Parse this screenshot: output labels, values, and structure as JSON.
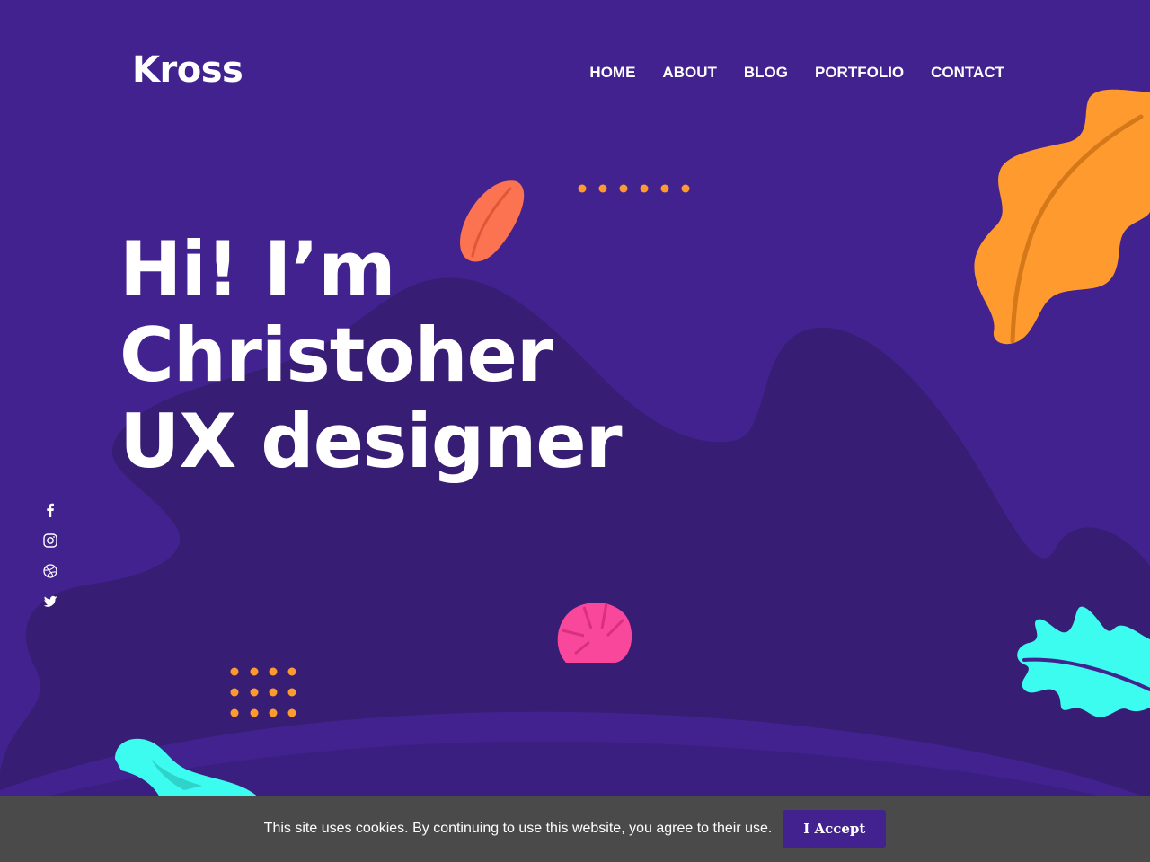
{
  "brand": {
    "logo_text": "Kross"
  },
  "nav": {
    "items": [
      {
        "label": "HOME"
      },
      {
        "label": "ABOUT"
      },
      {
        "label": "BLOG"
      },
      {
        "label": "PORTFOLIO"
      },
      {
        "label": "CONTACT"
      }
    ]
  },
  "hero": {
    "line1": "Hi! I’m",
    "line2": "Christoher",
    "line3": "UX designer"
  },
  "social": {
    "icons": [
      "facebook-icon",
      "instagram-icon",
      "dribbble-icon",
      "twitter-icon"
    ]
  },
  "cookie": {
    "message": "This site uses cookies. By continuing to use this website, you agree to their use.",
    "accept_label": "I Accept"
  },
  "colors": {
    "background": "#42228f",
    "blob": "#371d74",
    "accent_orange": "#ff9b2e",
    "accent_coral": "#fb7350",
    "accent_pink": "#f9479b",
    "accent_cyan": "#3cfbef",
    "cookie_bar": "#4a4a4a"
  }
}
